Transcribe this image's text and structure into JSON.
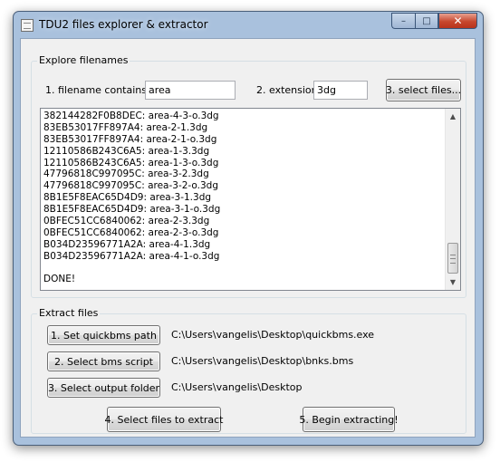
{
  "window": {
    "title": "TDU2 files explorer & extractor",
    "caption_buttons": {
      "minimize": "–",
      "maximize": "□",
      "close": "✕"
    }
  },
  "explore": {
    "group_label": "Explore filenames",
    "filename_label": "1. filename contains...",
    "filename_value": "area",
    "extension_label": "2. extension",
    "extension_value": "3dg",
    "select_files_button": "3. select files...",
    "output_lines": [
      "382144282F0B8DEC: area-4-3-o.3dg",
      "83EB53017FF897A4: area-2-1.3dg",
      "83EB53017FF897A4: area-2-1-o.3dg",
      "12110586B243C6A5: area-1-3.3dg",
      "12110586B243C6A5: area-1-3-o.3dg",
      "47796818C997095C: area-3-2.3dg",
      "47796818C997095C: area-3-2-o.3dg",
      "8B1E5F8EAC65D4D9: area-3-1.3dg",
      "8B1E5F8EAC65D4D9: area-3-1-o.3dg",
      "0BFEC51CC6840062: area-2-3.3dg",
      "0BFEC51CC6840062: area-2-3-o.3dg",
      "B034D23596771A2A: area-4-1.3dg",
      "B034D23596771A2A: area-4-1-o.3dg",
      "",
      "DONE!"
    ],
    "scroll_up": "▲",
    "scroll_down": "▼"
  },
  "extract": {
    "group_label": "Extract files",
    "quickbms_button": "1. Set quickbms path",
    "quickbms_path": "C:\\Users\\vangelis\\Desktop\\quickbms.exe",
    "bms_button": "2. Select bms script",
    "bms_path": "C:\\Users\\vangelis\\Desktop\\bnks.bms",
    "output_button": "3. Select output folder",
    "output_path": "C:\\Users\\vangelis\\Desktop",
    "files_button": "4. Select files to extract",
    "begin_button": "5. Begin extracting!"
  }
}
